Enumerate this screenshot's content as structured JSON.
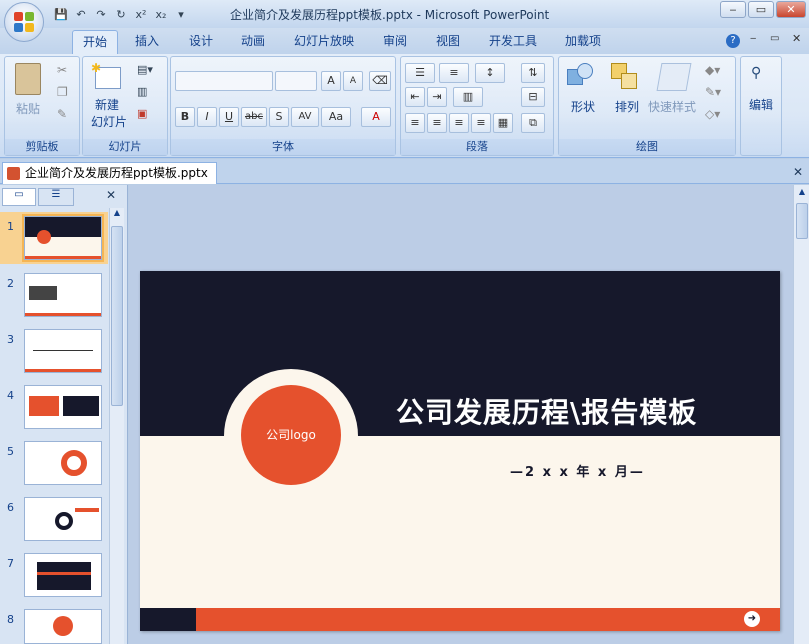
{
  "window": {
    "title": "企业简介及发展历程ppt模板.pptx - Microsoft PowerPoint",
    "controls": {
      "minimize": "‒",
      "maximize": "▭",
      "close": "✕"
    }
  },
  "qat": {
    "save": "💾",
    "undo": "↶",
    "redo": "↷",
    "refresh": "↻",
    "superscript": "x²",
    "subscript": "x₂",
    "more": "▾"
  },
  "tabs": [
    {
      "label": "开始",
      "active": true
    },
    {
      "label": "插入"
    },
    {
      "label": "设计"
    },
    {
      "label": "动画"
    },
    {
      "label": "幻灯片放映"
    },
    {
      "label": "审阅"
    },
    {
      "label": "视图"
    },
    {
      "label": "开发工具"
    },
    {
      "label": "加载项"
    }
  ],
  "ribbon": {
    "clipboard": {
      "label": "剪贴板",
      "paste": "粘贴"
    },
    "slides": {
      "label": "幻灯片",
      "new_slide_line1": "新建",
      "new_slide_line2": "幻灯片"
    },
    "font": {
      "label": "字体",
      "bold": "B",
      "italic": "I",
      "underline": "U",
      "strike": "abc",
      "shadow": "S",
      "spacing": "AV",
      "case": "Aa",
      "color": "A",
      "grow": "A",
      "shrink": "A"
    },
    "paragraph": {
      "label": "段落"
    },
    "drawing": {
      "label": "绘图",
      "shape": "形状",
      "arrange": "排列",
      "quick_styles": "快速样式"
    },
    "editing": {
      "label": "编辑"
    }
  },
  "doc_tab": {
    "label": "企业简介及发展历程ppt模板.pptx"
  },
  "slide_panel": {
    "numbers": [
      "1",
      "2",
      "3",
      "4",
      "5",
      "6",
      "7",
      "8"
    ],
    "selected": "1"
  },
  "slide": {
    "logo_text": "公司logo",
    "title": "公司发展历程\\报告模板",
    "date": "—2 x x 年 x 月—"
  },
  "colors": {
    "dark": "#16182b",
    "accent": "#e5512d",
    "cream": "#fcf6ec",
    "ribbon": "#dbe7f6"
  }
}
